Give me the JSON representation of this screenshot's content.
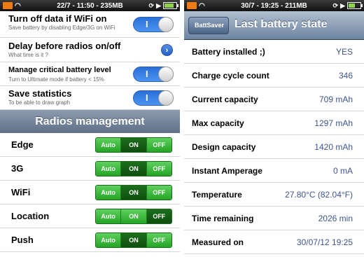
{
  "left": {
    "status": {
      "time": "22/7 - 11:50 - 235MB"
    },
    "settings": [
      {
        "title": "Turn off data if WiFi on",
        "sub": "Save battery by disabling Edge/3G on WiFi",
        "toggle": "I"
      },
      {
        "title": "Delay before radios on/off",
        "sub": "What time is it ?",
        "disclosure": "›"
      },
      {
        "title": "Manage critical battery level",
        "sub": "Turn to Ultimate mode if battery < 15%",
        "toggle": "I"
      },
      {
        "title": "Save statistics",
        "sub": "To be able to draw graph",
        "toggle": "I"
      }
    ],
    "section_title": "Radios management",
    "radios": [
      {
        "name": "Edge",
        "options": [
          "Auto",
          "ON",
          "OFF"
        ],
        "selected": "ON"
      },
      {
        "name": "3G",
        "options": [
          "Auto",
          "ON",
          "OFF"
        ],
        "selected": "ON"
      },
      {
        "name": "WiFi",
        "options": [
          "Auto",
          "ON",
          "OFF"
        ],
        "selected": "ON"
      },
      {
        "name": "Location",
        "options": [
          "Auto",
          "ON",
          "OFF"
        ],
        "selected": "OFF"
      },
      {
        "name": "Push",
        "options": [
          "Auto",
          "ON",
          "OFF"
        ],
        "selected": "ON"
      }
    ]
  },
  "right": {
    "status": {
      "time": "30/7 - 19:25 - 211MB"
    },
    "nav": {
      "back": "BattSaver",
      "title": "Last battery state"
    },
    "rows": [
      {
        "label": "Battery installed ;)",
        "value": "YES"
      },
      {
        "label": "Charge cycle count",
        "value": "346"
      },
      {
        "label": "Current capacity",
        "value": "709 mAh"
      },
      {
        "label": "Max capacity",
        "value": "1297 mAh"
      },
      {
        "label": "Design capacity",
        "value": "1420 mAh"
      },
      {
        "label": "Instant Amperage",
        "value": "0 mA"
      },
      {
        "label": "Temperature",
        "value": "27.80°C (82.04°F)"
      },
      {
        "label": "Time remaining",
        "value": "2026 min"
      },
      {
        "label": "Measured on",
        "value": "30/07/12 19:25"
      }
    ]
  },
  "colors": {
    "toggle_on": "#3b82e6",
    "segment_green": "#3cbf3c",
    "segment_selected": "#155c15",
    "value_blue": "#3d5590",
    "section_header": "#6f7f96"
  }
}
